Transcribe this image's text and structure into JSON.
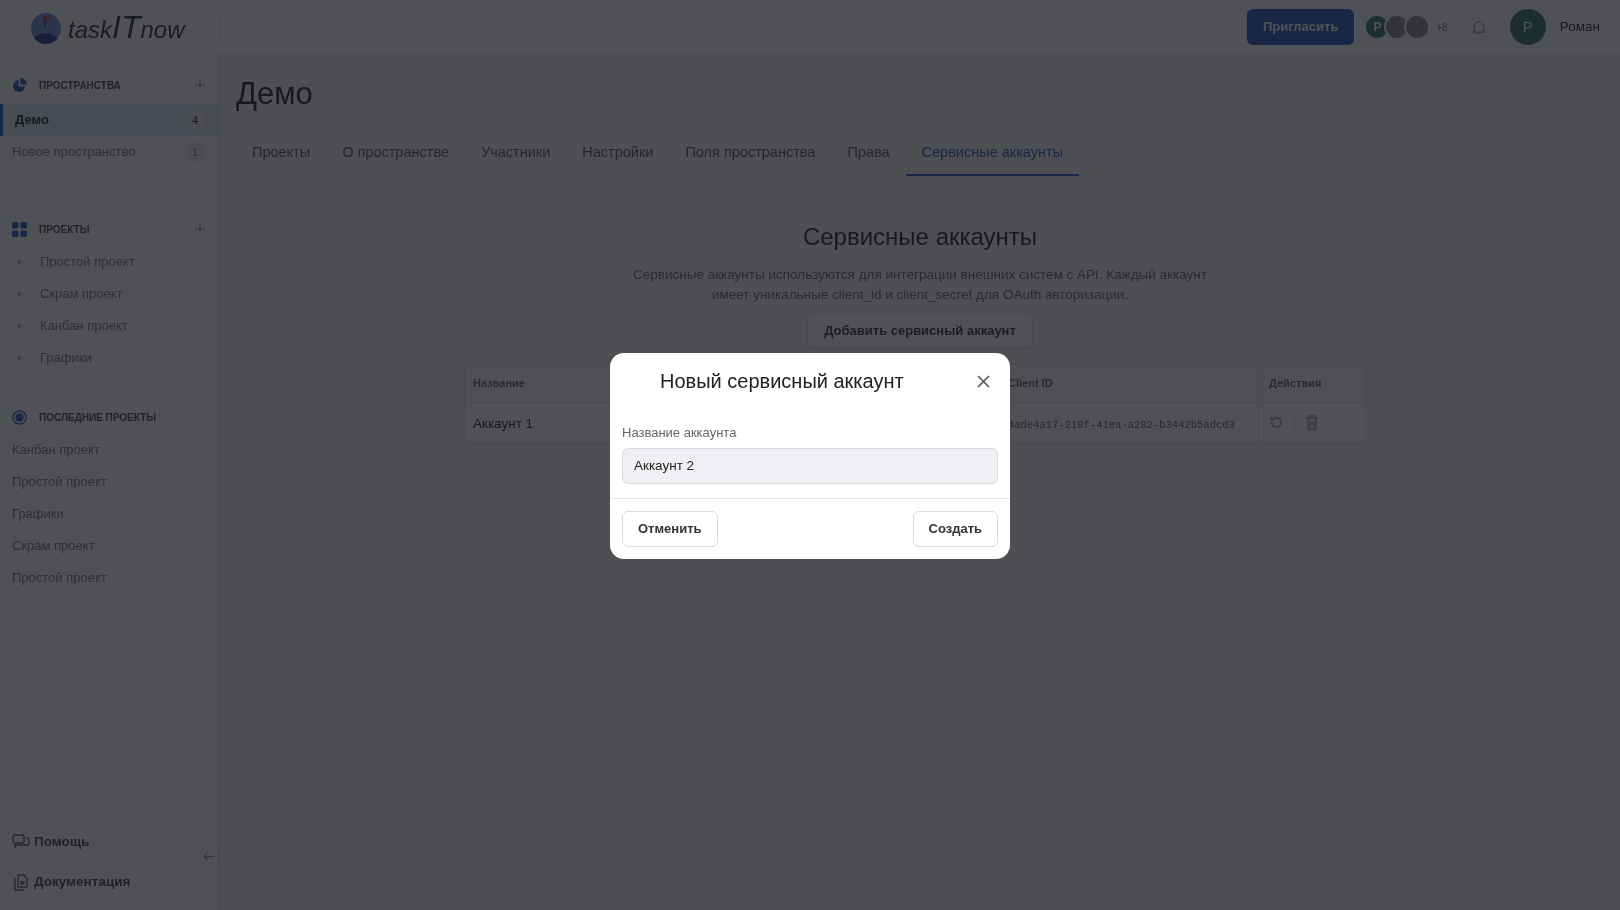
{
  "header": {
    "logo": [
      "task",
      "IT",
      "now"
    ],
    "invite_button": "Пригласить",
    "avatars": [
      {
        "kind": "initial",
        "initial": "Р"
      },
      {
        "kind": "photo"
      },
      {
        "kind": "photo"
      }
    ],
    "more_count": "+8",
    "user": {
      "initial": "Р",
      "name": "Роман"
    }
  },
  "sidebar": {
    "spaces": {
      "title": "ПРОСТРАНСТВА",
      "items": [
        {
          "label": "Демо",
          "count": "4",
          "selected": true
        },
        {
          "label": "Новое пространство",
          "count": "1",
          "selected": false
        }
      ]
    },
    "projects": {
      "title": "ПРОЕКТЫ",
      "items": [
        "Простой проект",
        "Скрам проект",
        "Канбан проект",
        "Графики"
      ]
    },
    "recent": {
      "title": "ПОСЛЕДНИЕ ПРОЕКТЫ",
      "items": [
        "Канбан проект",
        "Простой проект",
        "Графики",
        "Скрам проект",
        "Простой проект"
      ]
    },
    "footer": [
      "Помощь",
      "Документация"
    ]
  },
  "page": {
    "title": "Демо",
    "tabs": [
      {
        "label": "Проекты",
        "selected": false
      },
      {
        "label": "О пространстве",
        "selected": false
      },
      {
        "label": "Участники",
        "selected": false
      },
      {
        "label": "Настройки",
        "selected": false
      },
      {
        "label": "Поля пространства",
        "selected": false
      },
      {
        "label": "Права",
        "selected": false
      },
      {
        "label": "Сервисные аккаунты",
        "selected": true
      }
    ],
    "section_title": "Сервисные аккаунты",
    "description": "Сервисные аккаунты используются для интеграции внешних систем с API. Каждый аккаунт имеет уникальные client_id и client_secret для OAuth авторизации.",
    "add_button": "Добавить сервисный аккаунт",
    "table": {
      "columns": [
        "Название",
        "Client ID",
        "Действия"
      ],
      "rows": [
        {
          "name": "Аккаунт 1",
          "client_id": "4ade4a17-218f-41ea-a282-b3442b5adcd3"
        }
      ]
    }
  },
  "modal": {
    "title": "Новый сервисный аккаунт",
    "field_label": "Название аккаунта",
    "field_value": "Аккаунт 2",
    "cancel_button": "Отменить",
    "create_button": "Создать"
  }
}
